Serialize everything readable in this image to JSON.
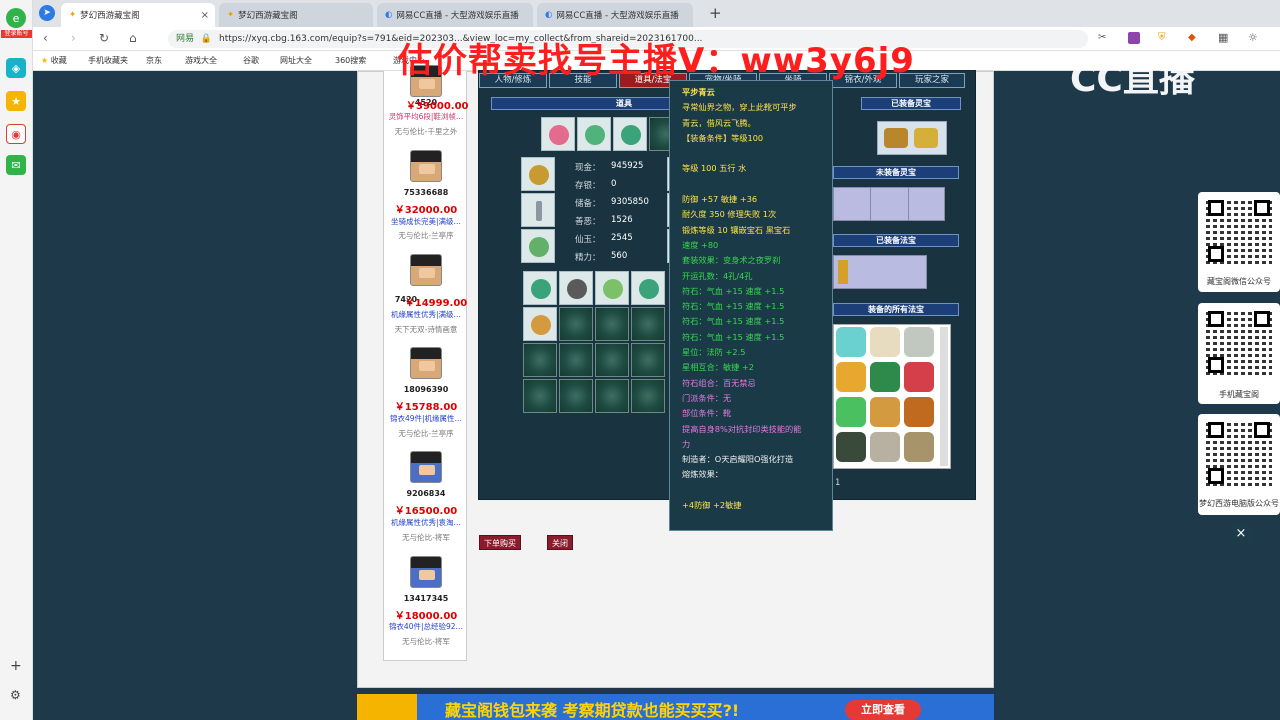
{
  "overlay_text": "估价帮卖找号主播V：ww3y6j9",
  "cc_logo": "CC直播",
  "browser": {
    "tabs": [
      {
        "label": "梦幻西游藏宝阁"
      },
      {
        "label": "梦幻西游藏宝阁"
      },
      {
        "label": "网易CC直播 - 大型游戏娱乐直播"
      },
      {
        "label": "网易CC直播 - 大型游戏娱乐直播"
      }
    ],
    "new_tab": "+",
    "site_badge": "网易",
    "url": "https://xyq.cbg.163.com/equip?s=791&eid=202303...&view_loc=my_collect&from_shareid=2023161700...",
    "login_badge": "登录账号"
  },
  "bookmarks": [
    "收藏",
    "手机收藏夹",
    "京东",
    "游戏大全",
    "谷歌",
    "网址大全",
    "360搜索",
    "游戏中心"
  ],
  "listings": [
    {
      "id": "4520",
      "price": "￥39000.00",
      "desc": "灵饰平均6段|鞋浏帧…",
      "desc_color": "pink",
      "server": "无与伦比-千里之外"
    },
    {
      "id": "75336688",
      "price": "￥32000.00",
      "desc": "坐骑成长完美|满级…",
      "desc_color": "blue",
      "server": "无与伦比-兰亭序"
    },
    {
      "id": "7420",
      "price": "￥14999.00",
      "desc": "机缘属性优秀|满级…",
      "desc_color": "blue",
      "server": "天下无双-诗情画意"
    },
    {
      "id": "18096390",
      "price": "￥15788.00",
      "desc": "锦衣49件|机缘属性…",
      "desc_color": "blue",
      "server": "无与伦比-兰亭序"
    },
    {
      "id": "9206834",
      "price": "￥16500.00",
      "desc": "机缘属性优秀|袁淘…",
      "desc_color": "blue",
      "server": "无与伦比-将军"
    },
    {
      "id": "13417345",
      "price": "￥18000.00",
      "desc": "锦衣40件|总经验92…",
      "desc_color": "blue",
      "server": "无与伦比-将军"
    }
  ],
  "game": {
    "tabs": [
      "人物/修炼",
      "技能",
      "道具/法宝",
      "宠物/坐骑",
      "坐骑",
      "锦衣/外观",
      "玩家之家"
    ],
    "section_headers": {
      "props": "道具",
      "equipped_lingbao": "已装备灵宝",
      "unequipped_lingbao": "未装备灵宝",
      "equipped_fabao": "已装备法宝",
      "all_fabao": "装备的所有法宝"
    },
    "stats": [
      {
        "label": "现金：",
        "value": "945925"
      },
      {
        "label": "存银：",
        "value": "0"
      },
      {
        "label": "储备：",
        "value": "9305850"
      },
      {
        "label": "善恶：",
        "value": "1526"
      },
      {
        "label": "仙玉：",
        "value": "2545"
      },
      {
        "label": "精力：",
        "value": "560"
      }
    ],
    "fabao_count": "1"
  },
  "tooltip": {
    "title": "平步青云",
    "lines": [
      {
        "text": "寻常仙界之物，穿上此靴可平步",
        "color": "y"
      },
      {
        "text": "青云，借风云飞腾。",
        "color": "y"
      },
      {
        "text": "【装备条件】等级100",
        "color": "y"
      },
      {
        "text": "",
        "color": "y"
      },
      {
        "text": "等级 100 五行 水",
        "color": "y"
      },
      {
        "text": "",
        "color": "y"
      },
      {
        "text": "防御 +57 敏捷 +36",
        "color": "y"
      },
      {
        "text": "耐久度 350 修理失败 1次",
        "color": "y"
      },
      {
        "text": "锻炼等级 10 镶嵌宝石 黑宝石",
        "color": "y"
      },
      {
        "text": "速度 +80",
        "color": "g"
      },
      {
        "text": "套装效果：变身术之夜罗刹",
        "color": "g"
      },
      {
        "text": "开运孔数：4孔/4孔",
        "color": "g"
      },
      {
        "text": "符石：气血 +15 速度 +1.5",
        "color": "g"
      },
      {
        "text": "符石：气血 +15 速度 +1.5",
        "color": "g"
      },
      {
        "text": "符石：气血 +15 速度 +1.5",
        "color": "g"
      },
      {
        "text": "符石：气血 +15 速度 +1.5",
        "color": "g"
      },
      {
        "text": "星位：法防 +2.5",
        "color": "g"
      },
      {
        "text": "星相互合：敏捷 +2",
        "color": "g"
      },
      {
        "text": "符石组合：百无禁忌",
        "color": "p"
      },
      {
        "text": "门派条件：无",
        "color": "p"
      },
      {
        "text": "部位条件：靴",
        "color": "p"
      },
      {
        "text": "提高自身8%对抗封印类技能的能",
        "color": "p"
      },
      {
        "text": "力",
        "color": "p"
      },
      {
        "text": "制造者：O天启耀阳O强化打造",
        "color": "w"
      },
      {
        "text": "熔炼效果：",
        "color": "w"
      },
      {
        "text": "",
        "color": "w"
      },
      {
        "text": "+4防御 +2敏捷",
        "color": "y"
      }
    ]
  },
  "buttons": {
    "buy": "下单购买",
    "close": "关闭"
  },
  "banner": {
    "text": "藏宝阁钱包来袭 考察期贷款也能买买买?!",
    "cta": "立即查看"
  },
  "qr_cards": [
    {
      "label": "藏宝阁微信公众号"
    },
    {
      "label": "手机藏宝阁"
    },
    {
      "label": "梦幻西游电脑版公众号"
    }
  ],
  "close_symbol": "×",
  "sidebar_add": "+"
}
